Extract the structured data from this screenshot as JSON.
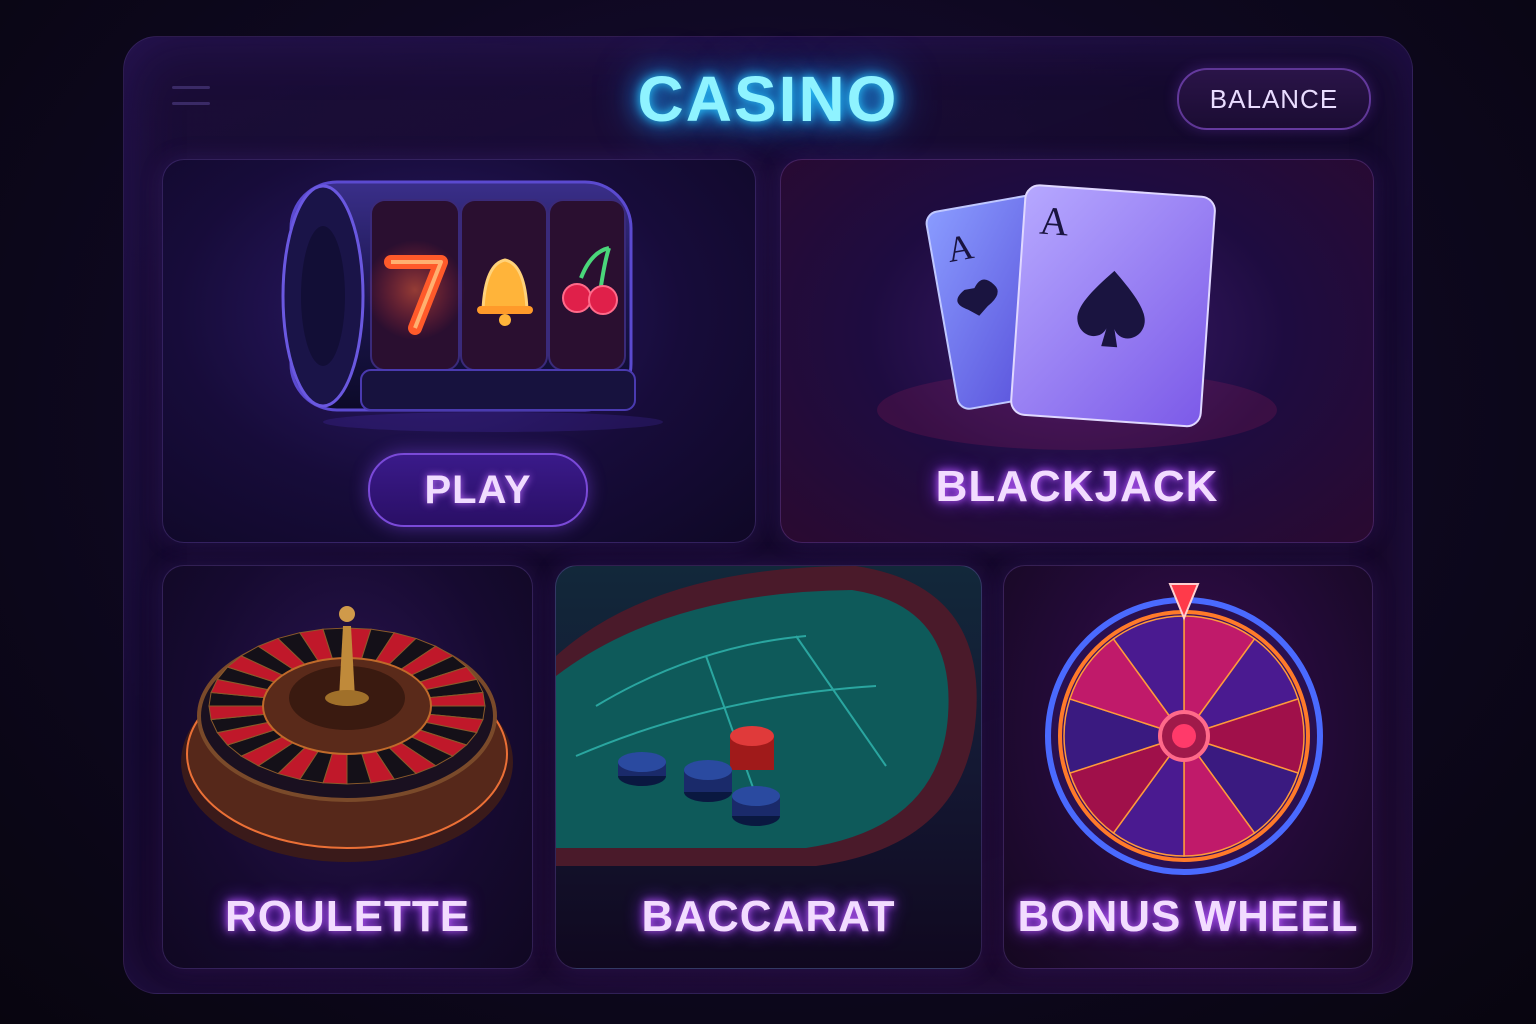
{
  "header": {
    "title": "CASINO",
    "balance_label": "BALANCE",
    "menu_icon": "hamburger-menu-icon"
  },
  "games": {
    "slots": {
      "button_label": "PLAY",
      "icon": "slot-machine-icon",
      "reel_symbols": [
        "7",
        "bell",
        "cherries"
      ]
    },
    "blackjack": {
      "label": "BLACKJACK",
      "icon": "playing-cards-icon",
      "card_rank": "A"
    },
    "roulette": {
      "label": "ROULETTE",
      "icon": "roulette-wheel-icon"
    },
    "baccarat": {
      "label": "BACCARAT",
      "icon": "baccarat-table-icon"
    },
    "bonus_wheel": {
      "label": "BONUS WHEEL",
      "icon": "prize-wheel-icon"
    }
  },
  "colors": {
    "title_glow": "#29c8ff",
    "label_glow": "#c060ff",
    "accent_purple": "#7a4ad8"
  }
}
